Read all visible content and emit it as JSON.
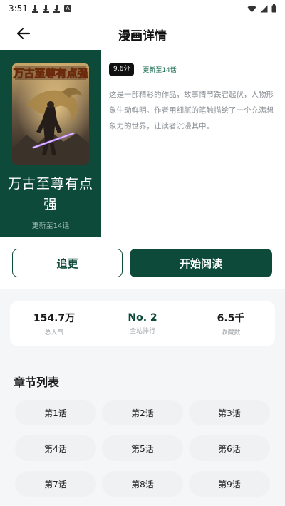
{
  "status_bar": {
    "time": "3:51",
    "letter_icon": "A",
    "icons": [
      "download-icon",
      "download-icon",
      "download-icon",
      "a-notification-icon",
      "wifi-icon",
      "signal-icon",
      "battery-icon"
    ]
  },
  "header": {
    "title": "漫画详情",
    "back_icon": "arrow-left-icon"
  },
  "comic": {
    "cover_title": "万古至尊有点强",
    "cover_logo_text": "万古至尊有点强",
    "cover_subtitle": "更新至14话",
    "score": "9.6分",
    "update": "更新至14话",
    "description": "这是一部精彩的作品，故事情节跌宕起伏，人物形象生动鲜明。作者用细腻的笔触描绘了一个充满想象力的世界，让读者沉浸其中。"
  },
  "actions": {
    "follow_label": "追更",
    "read_label": "开始阅读"
  },
  "stats": [
    {
      "value": "154.7万",
      "label": "总人气",
      "accent": false
    },
    {
      "value": "No. 2",
      "label": "全站排行",
      "accent": true
    },
    {
      "value": "6.5千",
      "label": "收藏数",
      "accent": false
    }
  ],
  "chapters": {
    "title": "章节列表",
    "items": [
      "第1话",
      "第2话",
      "第3话",
      "第4话",
      "第5话",
      "第6话",
      "第7话",
      "第8话",
      "第9话"
    ]
  },
  "colors": {
    "brand": "#0e4a3a",
    "accent_text": "#1b6b50",
    "background": "#f5f6f8",
    "chip": "#f0f1f3"
  }
}
